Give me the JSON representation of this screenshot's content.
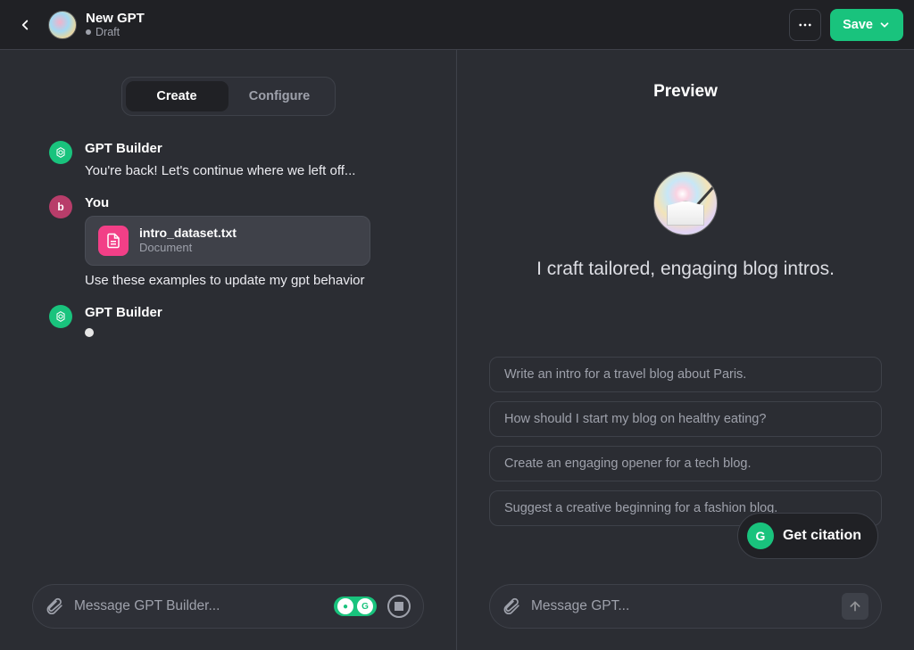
{
  "header": {
    "title": "New GPT",
    "status": "Draft",
    "save_label": "Save"
  },
  "tabs": {
    "create": "Create",
    "configure": "Configure"
  },
  "conversation": {
    "builder_name": "GPT Builder",
    "builder_msg": "You're back! Let's continue where we left off...",
    "user_name": "You",
    "file": {
      "name": "intro_dataset.txt",
      "type": "Document"
    },
    "user_msg": "Use these examples to update my gpt behavior",
    "builder_name_2": "GPT Builder"
  },
  "preview": {
    "title": "Preview",
    "tagline": "I craft tailored, engaging blog intros.",
    "suggestions": [
      "Write an intro for a travel blog about Paris.",
      "How should I start my blog on healthy eating?",
      "Create an engaging opener for a tech blog.",
      "Suggest a creative beginning for a fashion blog."
    ]
  },
  "inputs": {
    "left_placeholder": "Message GPT Builder...",
    "right_placeholder": "Message GPT..."
  },
  "citation_label": "Get citation"
}
